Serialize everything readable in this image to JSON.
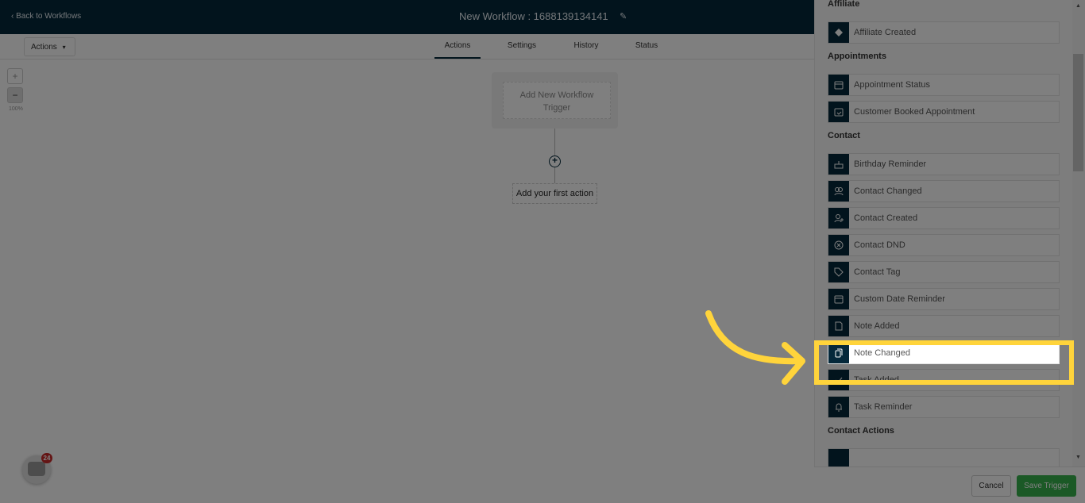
{
  "header": {
    "back_label": "Back to Workflows",
    "title": "New Workflow : 1688139134141"
  },
  "toolbar": {
    "actions_label": "Actions"
  },
  "tabs": [
    {
      "label": "Actions",
      "active": true
    },
    {
      "label": "Settings"
    },
    {
      "label": "History"
    },
    {
      "label": "Status"
    }
  ],
  "zoom": {
    "plus": "+",
    "minus": "−",
    "level": "100%"
  },
  "canvas": {
    "trigger_label": "Add New Workflow Trigger",
    "plus": "+",
    "first_action": "Add your first action"
  },
  "panel": {
    "sections": [
      {
        "title": "Affiliate",
        "items": [
          {
            "label": "Affiliate Created",
            "icon": "handshake-icon"
          }
        ]
      },
      {
        "title": "Appointments",
        "items": [
          {
            "label": "Appointment Status",
            "icon": "calendar-icon"
          },
          {
            "label": "Customer Booked Appointment",
            "icon": "calendar-check-icon"
          }
        ]
      },
      {
        "title": "Contact",
        "items": [
          {
            "label": "Birthday Reminder",
            "icon": "cake-icon"
          },
          {
            "label": "Contact Changed",
            "icon": "users-icon"
          },
          {
            "label": "Contact Created",
            "icon": "user-plus-icon"
          },
          {
            "label": "Contact DND",
            "icon": "block-icon"
          },
          {
            "label": "Contact Tag",
            "icon": "tag-icon"
          },
          {
            "label": "Custom Date Reminder",
            "icon": "calendar-icon"
          },
          {
            "label": "Note Added",
            "icon": "note-icon"
          },
          {
            "label": "Note Changed",
            "icon": "notes-copy-icon",
            "highlighted": true
          },
          {
            "label": "Task Added",
            "icon": "check-icon"
          },
          {
            "label": "Task Reminder",
            "icon": "bell-icon"
          }
        ]
      },
      {
        "title": "Contact Actions",
        "items": [
          {
            "label": "",
            "icon": "item-icon"
          }
        ]
      }
    ],
    "cancel_label": "Cancel",
    "save_label": "Save Trigger"
  },
  "chat": {
    "badge": "24"
  },
  "colors": {
    "header": "#04283a",
    "save": "#37b24d",
    "highlight": "#ffd43b",
    "badge": "#c92a2a"
  }
}
